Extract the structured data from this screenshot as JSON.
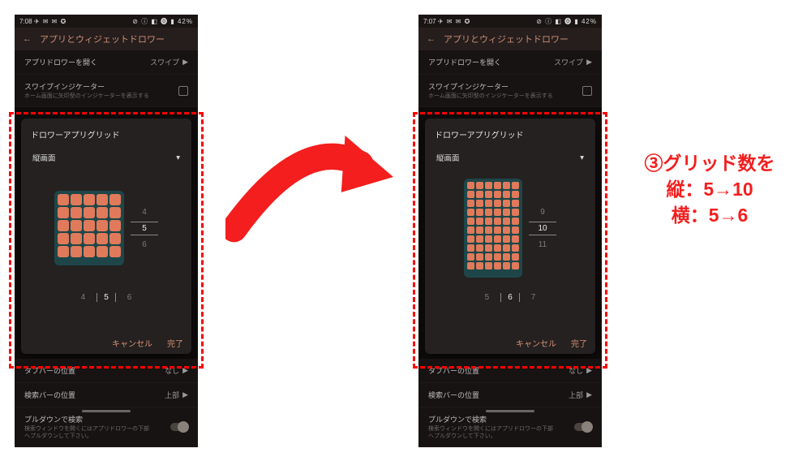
{
  "annotation": {
    "line1": "③グリッド数を",
    "line2": "縦：5→10",
    "line3": "横：5→6"
  },
  "statusbar_left": {
    "time": "7:08",
    "icons": "✈ ✉ ✉ ✪"
  },
  "statusbar_right": {
    "time": "7:07",
    "icons": "✈ ✉ ✉ ✪"
  },
  "statusbar_r": "⊘ ⓘ ◧ ⓿ ▮ 42%",
  "appbar_title": "アプリとウィジェットドロワー",
  "rows": {
    "openDrawer_label": "アプリドロワーを開く",
    "openDrawer_value": "スワイプ",
    "swipeIndicator_label": "スワイプインジケーター",
    "swipeIndicator_sub": "ホーム画面に矢印型のインジケーターを表示する",
    "tabbar_label": "タブバーの位置",
    "tabbar_value": "なし",
    "searchbar_label": "検索バーの位置",
    "searchbar_value": "上部",
    "pulldown_label": "プルダウンで検索",
    "pulldown_sub": "検索ウィンドウを開くにはアプリドロワーの下部\nへプルダウンして下さい。"
  },
  "dialog": {
    "title": "ドロワーアプリグリッド",
    "orientation": "縦画面",
    "cancel": "キャンセル",
    "ok": "完了"
  },
  "left_state": {
    "rows_prev": "4",
    "rows_sel": "5",
    "rows_next": "6",
    "cols_prev": "4",
    "cols_sel": "5",
    "cols_next": "6",
    "grid_rows": 5,
    "grid_cols": 5
  },
  "right_state": {
    "rows_prev": "9",
    "rows_sel": "10",
    "rows_next": "11",
    "cols_prev": "5",
    "cols_sel": "6",
    "cols_next": "7",
    "grid_rows": 10,
    "grid_cols": 6
  }
}
